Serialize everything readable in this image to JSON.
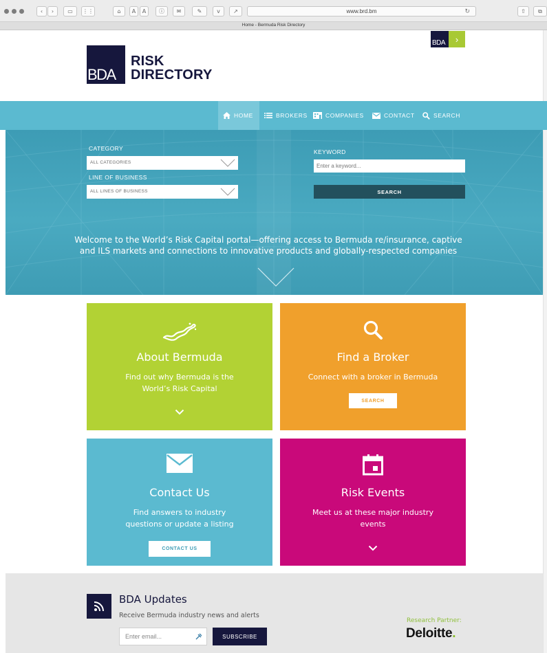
{
  "browser": {
    "url": "www.brd.bm",
    "tab_title": "Home - Bermuda Risk Directory"
  },
  "header": {
    "logo_mark": "BDA",
    "logo_line1": "RISK",
    "logo_line2": "DIRECTORY",
    "badge_text": "BDA"
  },
  "nav": {
    "items": [
      {
        "label": "HOME",
        "icon": "home-icon",
        "active": true
      },
      {
        "label": "BROKERS",
        "icon": "list-icon"
      },
      {
        "label": "COMPANIES",
        "icon": "building-icon"
      },
      {
        "label": "CONTACT",
        "icon": "envelope-icon"
      },
      {
        "label": "SEARCH",
        "icon": "search-icon"
      }
    ],
    "active_color": "#7ac8da"
  },
  "search": {
    "category_label": "CATEGORY",
    "category_value": "ALL CATEGORIES",
    "lob_label": "LINE OF BUSINESS",
    "lob_value": "ALL LINES OF BUSINESS",
    "keyword_label": "KEYWORD",
    "keyword_placeholder": "Enter a keyword...",
    "button_label": "SEARCH"
  },
  "hero": {
    "welcome_line1": "Welcome to the World’s Risk Capital portal—offering access to Bermuda re/insurance, captive",
    "welcome_line2": "and ILS markets and connections to innovative products and globally-respected companies"
  },
  "tiles": [
    {
      "title": "About Bermuda",
      "desc_line1": "Find out why Bermuda is the",
      "desc_line2": "World’s Risk Capital",
      "color": "#b2d234",
      "icon": "bermuda-island-icon"
    },
    {
      "title": "Find a Broker",
      "desc_line1": "Connect with a broker in Bermuda",
      "button": "SEARCH",
      "color": "#f0a02c",
      "icon": "search-icon"
    },
    {
      "title": "Contact Us",
      "desc_line1": "Find answers to industry",
      "desc_line2": "questions or update a listing",
      "button": "CONTACT US",
      "color": "#5bbad0",
      "icon": "envelope-icon"
    },
    {
      "title": "Risk Events",
      "desc_line1": "Meet us at these major industry",
      "desc_line2": "events",
      "color": "#c9097a",
      "icon": "calendar-icon"
    }
  ],
  "footer": {
    "updates_title": "BDA Updates",
    "updates_subtitle": "Receive Bermuda industry news and alerts",
    "email_placeholder": "Enter email...",
    "subscribe_label": "SUBSCRIBE",
    "partner_label": "Research Partner:",
    "partner_name": "Deloitte",
    "partner_dot": "."
  },
  "colors": {
    "navy": "#16173d",
    "teal": "#5bbad0",
    "lime": "#b2d234",
    "orange": "#f0a02c",
    "magenta": "#c9097a"
  }
}
